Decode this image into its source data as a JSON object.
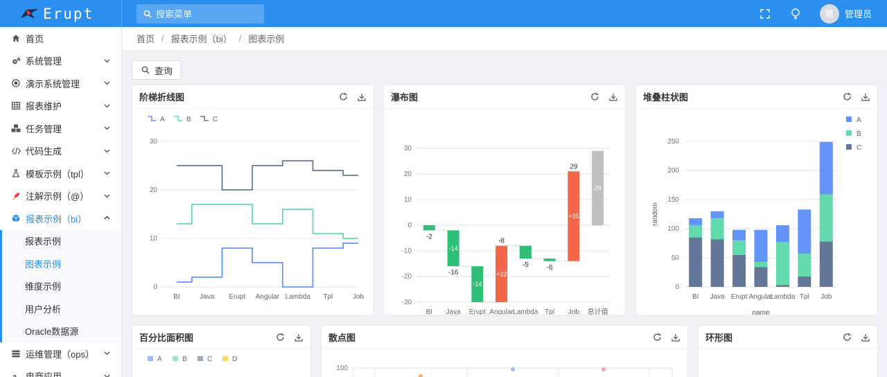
{
  "header": {
    "logo_text": "Erupt",
    "search_placeholder": "搜索菜单",
    "avatar_text": "管",
    "username": "管理员"
  },
  "sidebar": {
    "items": [
      {
        "label": "首页",
        "icon": "home-icon"
      },
      {
        "label": "系统管理",
        "icon": "cogs-icon"
      },
      {
        "label": "演示系统管理",
        "icon": "radio-icon"
      },
      {
        "label": "报表维护",
        "icon": "table-icon"
      },
      {
        "label": "任务管理",
        "icon": "cubes-icon"
      },
      {
        "label": "代码生成",
        "icon": "code-icon"
      },
      {
        "label": "模板示例（tpl）",
        "icon": "flask-icon"
      },
      {
        "label": "注解示例（@）",
        "icon": "rocket-icon"
      },
      {
        "label": "报表示例（bi）",
        "icon": "cube-icon"
      }
    ],
    "sub_items": [
      {
        "label": "报表示例"
      },
      {
        "label": "图表示例"
      },
      {
        "label": "维度示例"
      },
      {
        "label": "用户分析"
      },
      {
        "label": "Oracle数据源"
      }
    ],
    "after_items": [
      {
        "label": "运维管理（ops）",
        "icon": "server-icon"
      },
      {
        "label": "电商应用",
        "icon": "amazon-icon"
      }
    ]
  },
  "breadcrumb": [
    "首页",
    "报表示例（bi）",
    "图表示例"
  ],
  "query_button": "查询",
  "cards": {
    "step": "阶梯折线图",
    "waterfall": "瀑布图",
    "stacked": "堆叠柱状图",
    "percent": "百分比面积图",
    "scatter": "散点图",
    "ring": "环形图"
  },
  "colors": {
    "topbar": "#2b8ff0",
    "A": "#6395f9",
    "B": "#62daab",
    "C": "#657798",
    "D": "#f6c022",
    "inc": "#f4664a",
    "dec": "#30bf78",
    "total": "#c0c0c0"
  },
  "chart_data": [
    {
      "type": "line",
      "title": "阶梯折线图",
      "categories": [
        "BI",
        "Java",
        "Erupt",
        "Angular",
        "Lambda",
        "Tpl",
        "Job"
      ],
      "ylim": [
        0,
        30
      ],
      "yticks": [
        0,
        10,
        20,
        30
      ],
      "legend": "top-left",
      "series": [
        {
          "name": "A",
          "values": [
            1,
            2,
            8,
            5,
            0,
            8,
            9
          ]
        },
        {
          "name": "B",
          "values": [
            13,
            17,
            17,
            13,
            16,
            11,
            10
          ]
        },
        {
          "name": "C",
          "values": [
            25,
            25,
            20,
            25,
            26,
            24,
            23
          ]
        }
      ]
    },
    {
      "type": "bar",
      "title": "瀑布图",
      "categories": [
        "BI",
        "Java",
        "Erupt",
        "Angular",
        "Lambda",
        "Tpl",
        "Job",
        "总计值"
      ],
      "values": [
        -2,
        -14,
        -14,
        22,
        -5,
        -1,
        35,
        29
      ],
      "running_totals": [
        -2,
        -16,
        -30,
        -8,
        -13,
        -14,
        21,
        29
      ],
      "top_labels": [
        "-2",
        "-16",
        "",
        "-8",
        "-5",
        "-6",
        "29",
        ""
      ],
      "inner_labels": [
        "",
        "-14",
        "-14",
        "+22",
        "",
        "",
        "+35",
        "29"
      ],
      "ylim": [
        -30,
        30
      ],
      "yticks": [
        -30,
        -20,
        -10,
        0,
        10,
        20,
        30
      ]
    },
    {
      "type": "bar",
      "title": "堆叠柱状图",
      "categories": [
        "BI",
        "Java",
        "Erupt",
        "Angular",
        "Lambda",
        "Tpl",
        "Job"
      ],
      "series": [
        {
          "name": "C",
          "values": [
            85,
            82,
            55,
            34,
            3,
            18,
            78
          ]
        },
        {
          "name": "B",
          "values": [
            21,
            36,
            25,
            9,
            74,
            39,
            81
          ]
        },
        {
          "name": "A",
          "values": [
            12,
            12,
            18,
            55,
            29,
            76,
            90
          ]
        }
      ],
      "xlabel": "name",
      "ylabel": "random",
      "ylim": [
        0,
        250
      ],
      "yticks": [
        0,
        50,
        100,
        150,
        200,
        250
      ],
      "legend": "top-right"
    },
    {
      "type": "area",
      "title": "百分比面积图",
      "series": [
        {
          "name": "A"
        },
        {
          "name": "B"
        },
        {
          "name": "C"
        },
        {
          "name": "D"
        }
      ],
      "legend": "top-left"
    },
    {
      "type": "scatter",
      "title": "散点图",
      "yticks": [
        100
      ]
    }
  ]
}
